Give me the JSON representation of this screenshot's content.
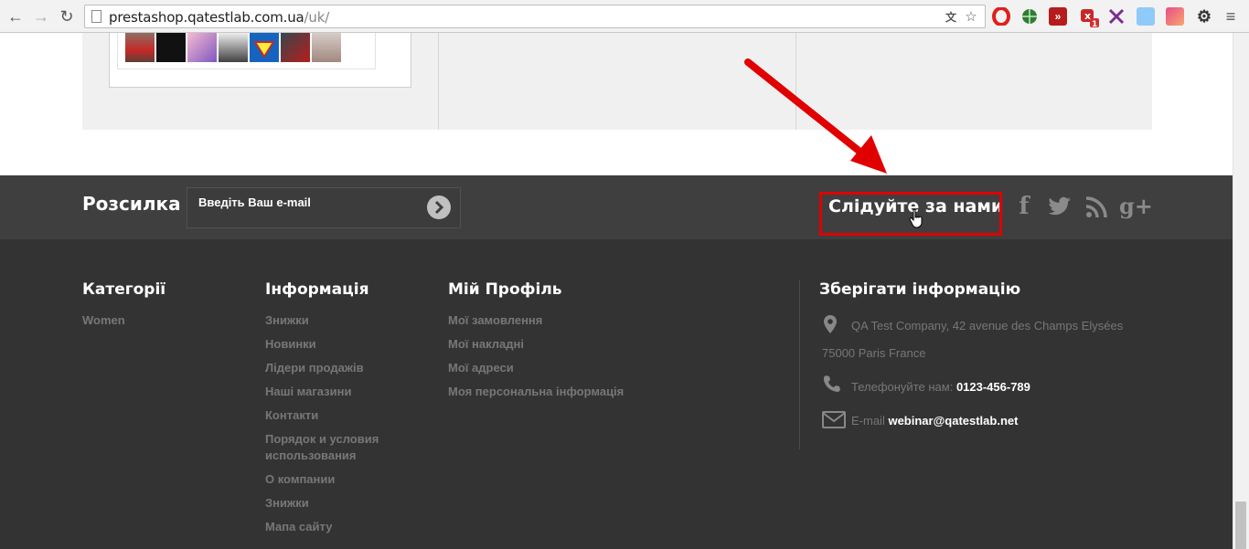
{
  "browser": {
    "url_host": "prestashop.qatestlab.com.ua",
    "url_path": "/uk/",
    "ext_badge": "1",
    "colors": {
      "opera": "#e0201b",
      "globe": "#2e7d32",
      "ext_red": "#b71c1c",
      "ext_x": "#7b2c8c",
      "ext_pink": "#e84c8a"
    }
  },
  "newsletter": {
    "title": "Розсилка",
    "placeholder": "Введіть Ваш e-mail",
    "submit_icon": "chevron-right-icon"
  },
  "follow": {
    "title": "Слідуйте за нами",
    "social": {
      "facebook": "f",
      "twitter": "🐦",
      "rss": "rss",
      "googleplus": "g+"
    },
    "highlight_color": "#e00000"
  },
  "footer": {
    "categories": {
      "title": "Категорії",
      "links": [
        "Women"
      ]
    },
    "information": {
      "title": "Інформація",
      "links": [
        "Знижки",
        "Новинки",
        "Лідери продажів",
        "Наші магазини",
        "Контакти",
        "Порядок и условия",
        "использования",
        "О компании",
        "Знижки",
        "Мапа сайту"
      ]
    },
    "profile": {
      "title": "Мій Профіль",
      "links": [
        "Мої замовлення",
        "Мої накладні",
        "Мої адреси",
        "Моя персональна інформація"
      ]
    },
    "store": {
      "title": "Зберігати інформацію",
      "address_line1": "QA Test Company, 42 avenue des Champs Elysées",
      "address_line2": "75000 Paris France",
      "phone_label": "Телефонуйте нам:",
      "phone": "0123-456-789",
      "email_label": "E-mail",
      "email": "webinar@qatestlab.net"
    }
  },
  "annotation_color": "#e00000"
}
